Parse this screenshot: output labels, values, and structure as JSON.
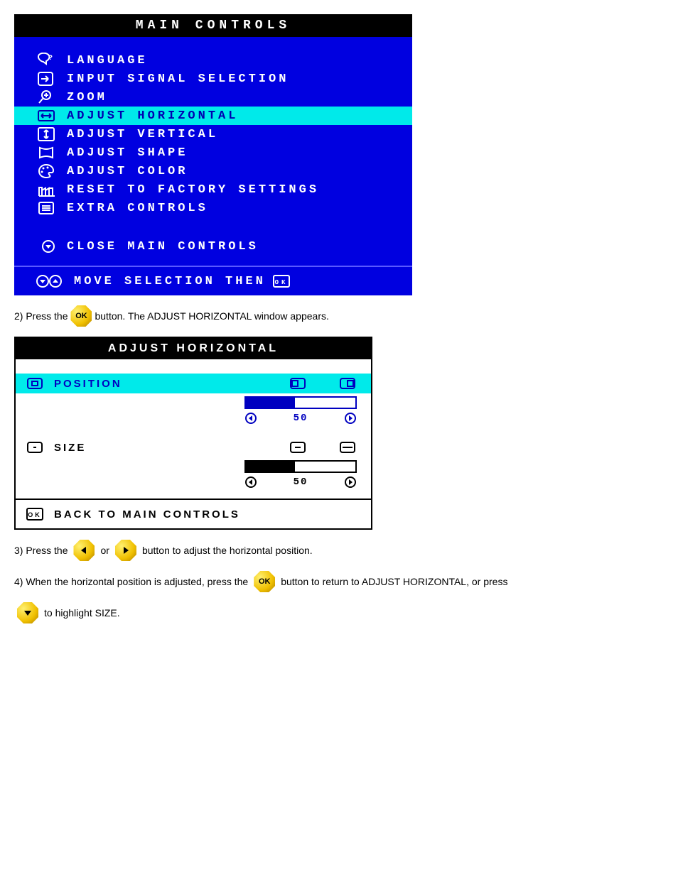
{
  "main": {
    "title": "MAIN CONTROLS",
    "items": [
      {
        "label": "LANGUAGE",
        "icon": "speech-question-icon",
        "highlighted": false
      },
      {
        "label": "INPUT SIGNAL SELECTION",
        "icon": "arrow-input-icon",
        "highlighted": false
      },
      {
        "label": "ZOOM",
        "icon": "magnifier-plus-icon",
        "highlighted": false
      },
      {
        "label": "ADJUST HORIZONTAL",
        "icon": "adjust-horizontal-icon",
        "highlighted": true
      },
      {
        "label": "ADJUST VERTICAL",
        "icon": "adjust-vertical-icon",
        "highlighted": false
      },
      {
        "label": "ADJUST SHAPE",
        "icon": "adjust-shape-icon",
        "highlighted": false
      },
      {
        "label": "ADJUST COLOR",
        "icon": "palette-icon",
        "highlighted": false
      },
      {
        "label": "RESET TO FACTORY SETTINGS",
        "icon": "factory-icon",
        "highlighted": false
      },
      {
        "label": "EXTRA CONTROLS",
        "icon": "list-icon",
        "highlighted": false
      }
    ],
    "close": "CLOSE MAIN CONTROLS",
    "footer": "MOVE SELECTION THEN"
  },
  "step_ok": {
    "prefix": "2) Press the ",
    "suffix": " button. The ADJUST HORIZONTAL window appears."
  },
  "adjust": {
    "title": "ADJUST HORIZONTAL",
    "rows": [
      {
        "label": "POSITION",
        "value": "50",
        "fill_pct": 45,
        "highlighted": true
      },
      {
        "label": "SIZE",
        "value": "50",
        "fill_pct": 45,
        "highlighted": false
      }
    ],
    "back": "BACK TO MAIN CONTROLS"
  },
  "step_lr": {
    "prefix": "3) Press the ",
    "mid": " or ",
    "suffix": " button to adjust the horizontal position."
  },
  "step_size": {
    "prefix": "4) When the horizontal position is adjusted, press the ",
    "suffix": " button to return to ADJUST HORIZONTAL, or press"
  },
  "step_down": " to highlight SIZE."
}
